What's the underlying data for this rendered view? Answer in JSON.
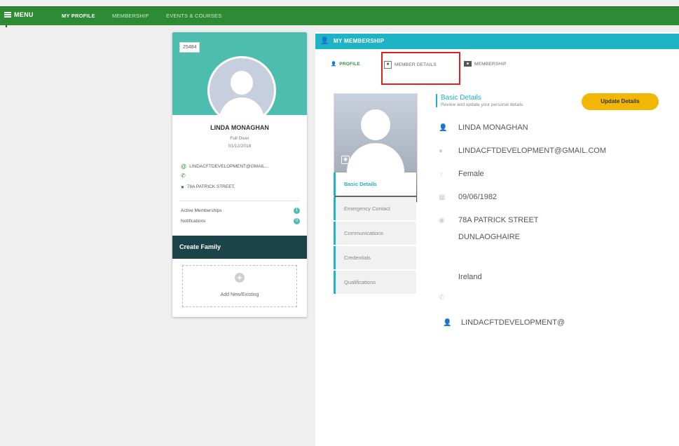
{
  "topbar": {
    "menu_label": "MENU",
    "nav": [
      "MY PROFILE",
      "MEMBERSHIP",
      "EVENTS & COURSES"
    ]
  },
  "profile_card": {
    "member_id": "25484",
    "name": "LINDA MONAGHAN",
    "member_type": "Full Diver",
    "date": "01/12/2018",
    "email": "LINDACFTDEVELOPMENT@GMAIL...",
    "phone": "",
    "address": "78A PATRICK STREET,",
    "active_memberships_label": "Active Memberships",
    "notifications_label": "Notifications",
    "active_memberships_count": "1",
    "notifications_count": "0",
    "create_family_label": "Create Family",
    "add_new_label": "Add New/Existing"
  },
  "panel": {
    "title": "MY MEMBERSHIP",
    "tabs": [
      "PROFILE",
      "MEMBER DETAILS",
      "MEMBERSHIP"
    ],
    "side_menu": [
      "Basic Details",
      "Emergency Contact",
      "Communications",
      "Credentials",
      "Qualifications"
    ],
    "basic_details_title": "Basic Details",
    "basic_details_subtitle": "Review and update your personal details",
    "update_button": "Update Details",
    "fields": {
      "name": "LINDA MONAGHAN",
      "email": "LINDACFTDEVELOPMENT@GMAIL.COM",
      "gender": "Female",
      "dob": "09/06/1982",
      "address_line1": "78A PATRICK STREET",
      "address_line2": "DUNLAOGHAIRE",
      "country": "Ireland",
      "phone": "",
      "username": "LINDACFTDEVELOPMENT@"
    }
  },
  "colors": {
    "topbar": "#2e8b35",
    "teal": "#1fb3c6",
    "card_header": "#4dbdb0",
    "family_bar": "#1c4347",
    "update_button": "#f2b705",
    "highlight": "#e02020"
  }
}
